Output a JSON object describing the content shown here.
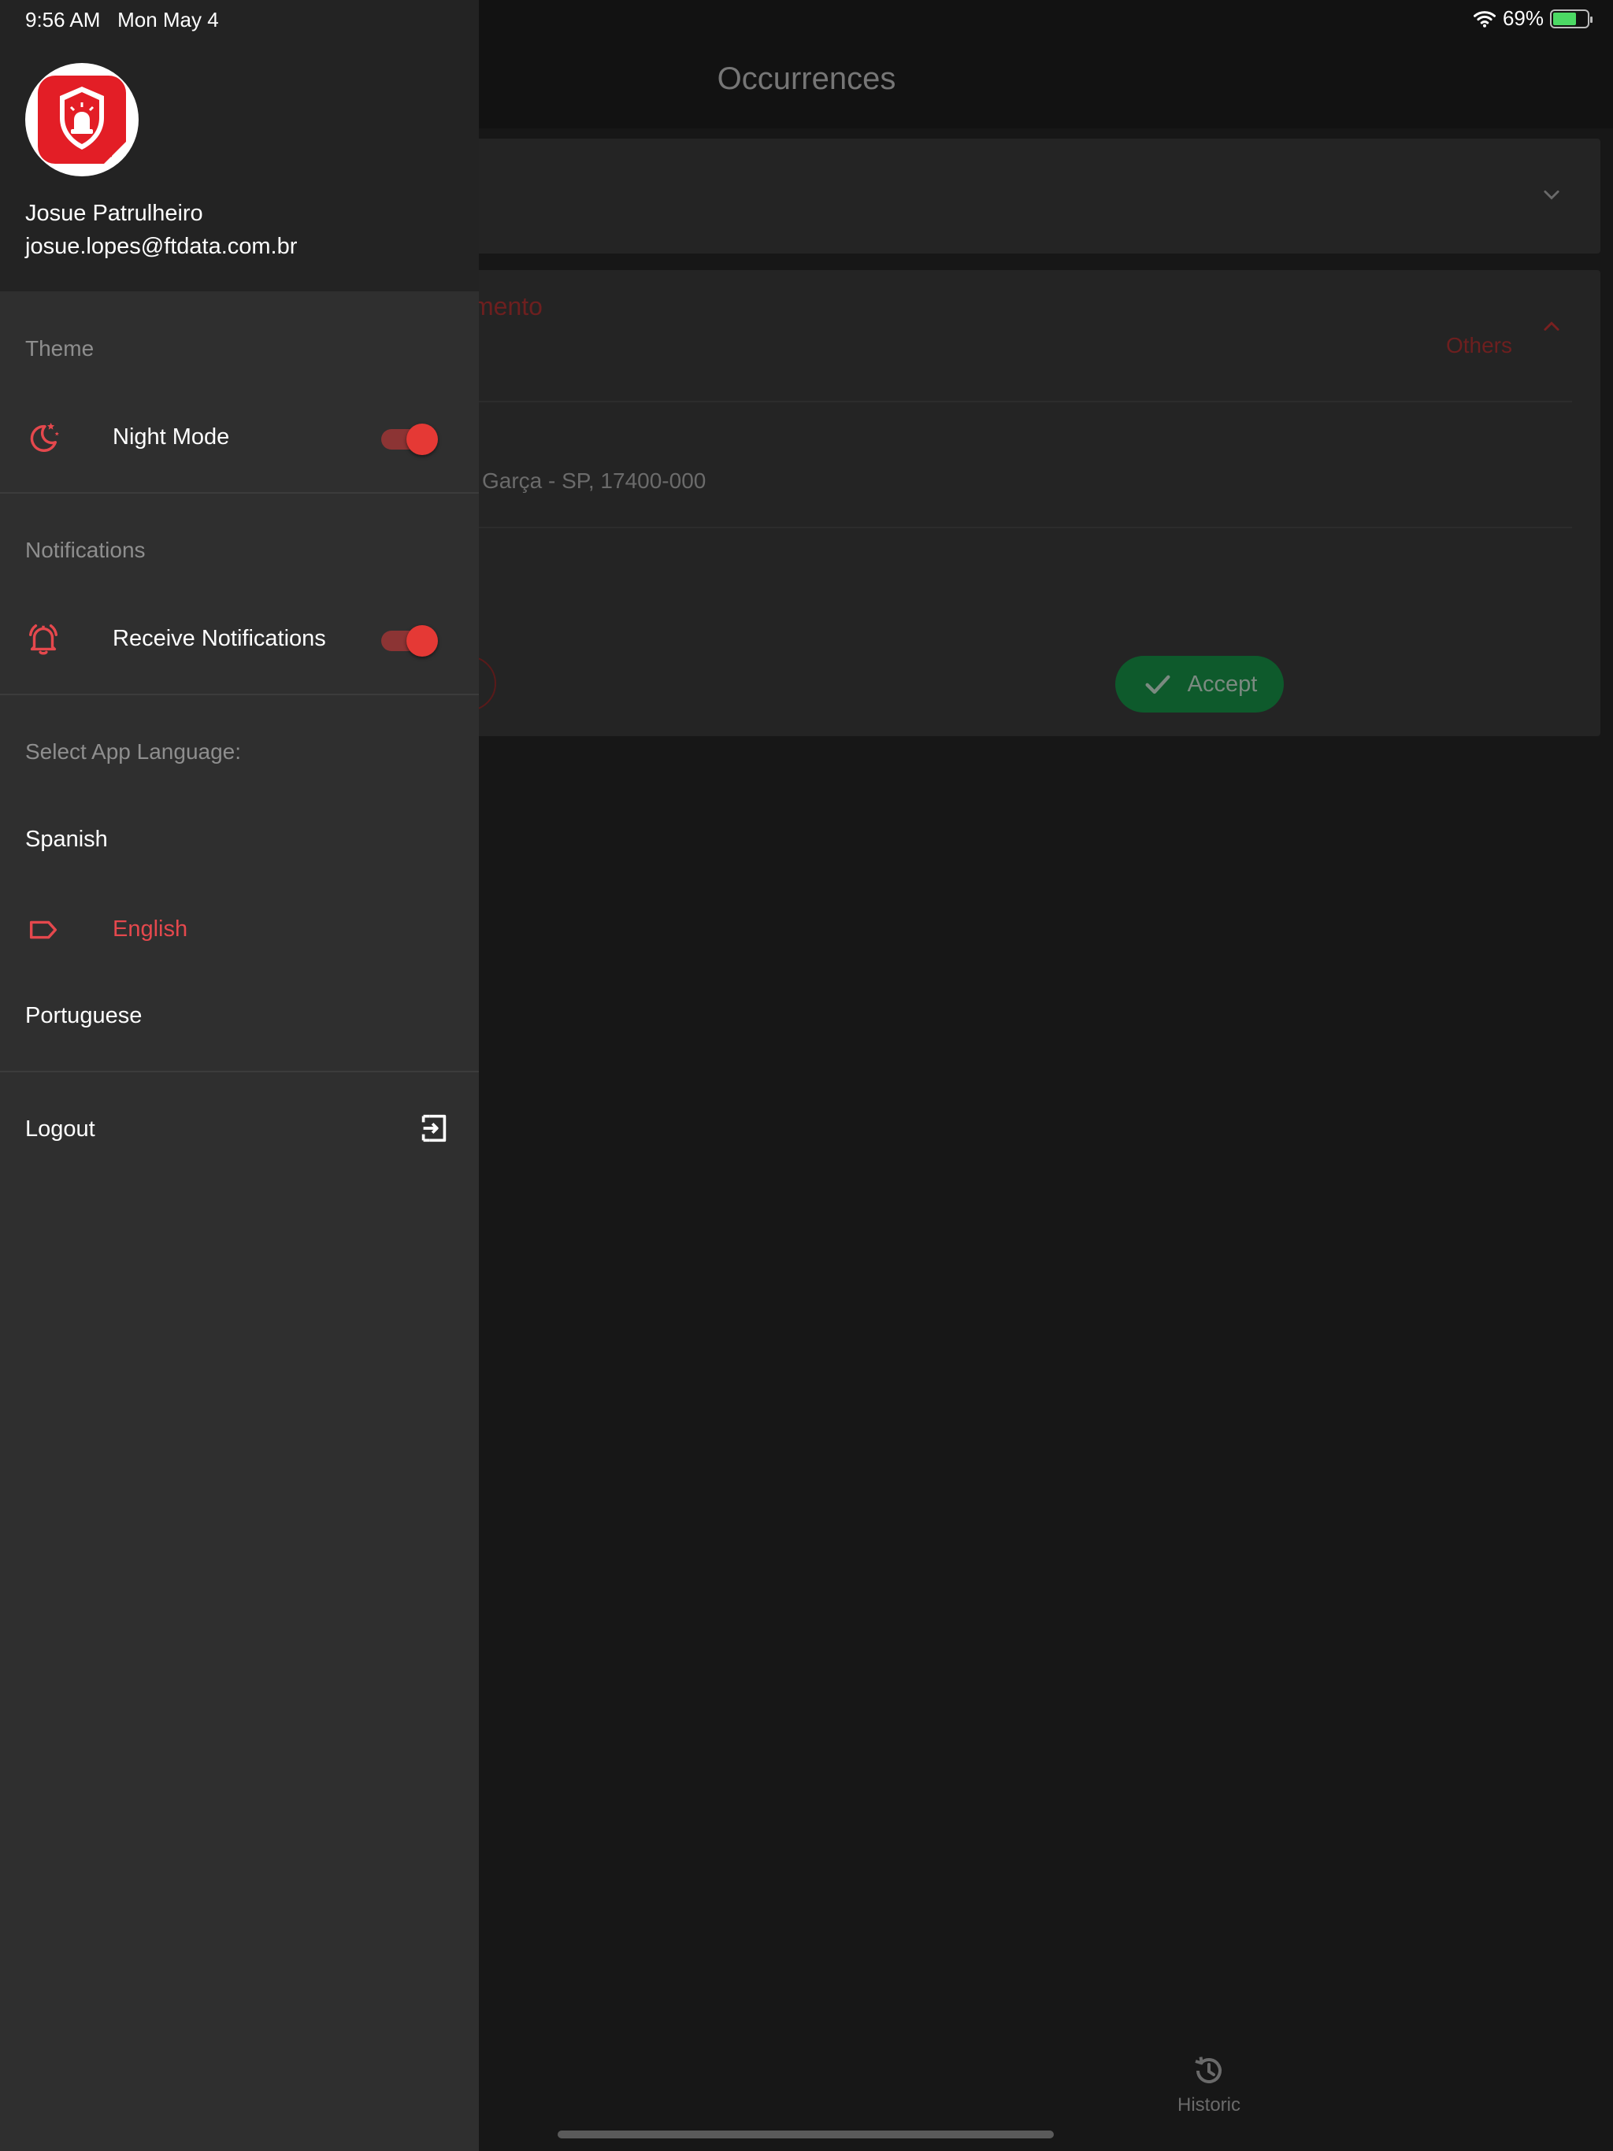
{
  "status_bar": {
    "time": "9:56 AM",
    "date": "Mon May 4",
    "battery_percent": "69%",
    "battery_level": 0.69,
    "icons": [
      "wifi-icon",
      "battery-charging-icon"
    ]
  },
  "app": {
    "title": "Occurrences",
    "occurrence": {
      "title_partial": "mento",
      "category": "Others",
      "address_partial": "Garça - SP, 17400-000",
      "accept_label": "Accept"
    },
    "bottom_nav": {
      "historic_label": "Historic"
    }
  },
  "drawer": {
    "user": {
      "name": "Josue Patrulheiro",
      "email": "josue.lopes@ftdata.com.br"
    },
    "theme": {
      "section_label": "Theme",
      "night_mode_label": "Night Mode",
      "night_mode_on": true
    },
    "notifications": {
      "section_label": "Notifications",
      "receive_label": "Receive Notifications",
      "receive_on": true
    },
    "language": {
      "section_label": "Select App Language:",
      "options": [
        "Spanish",
        "English",
        "Portuguese"
      ],
      "selected": "English"
    },
    "logout_label": "Logout"
  },
  "colors": {
    "accent": "#e53935",
    "drawer_bg": "#2f2f2f",
    "header_bg": "#232323",
    "accept_green": "#0e5a2c"
  }
}
